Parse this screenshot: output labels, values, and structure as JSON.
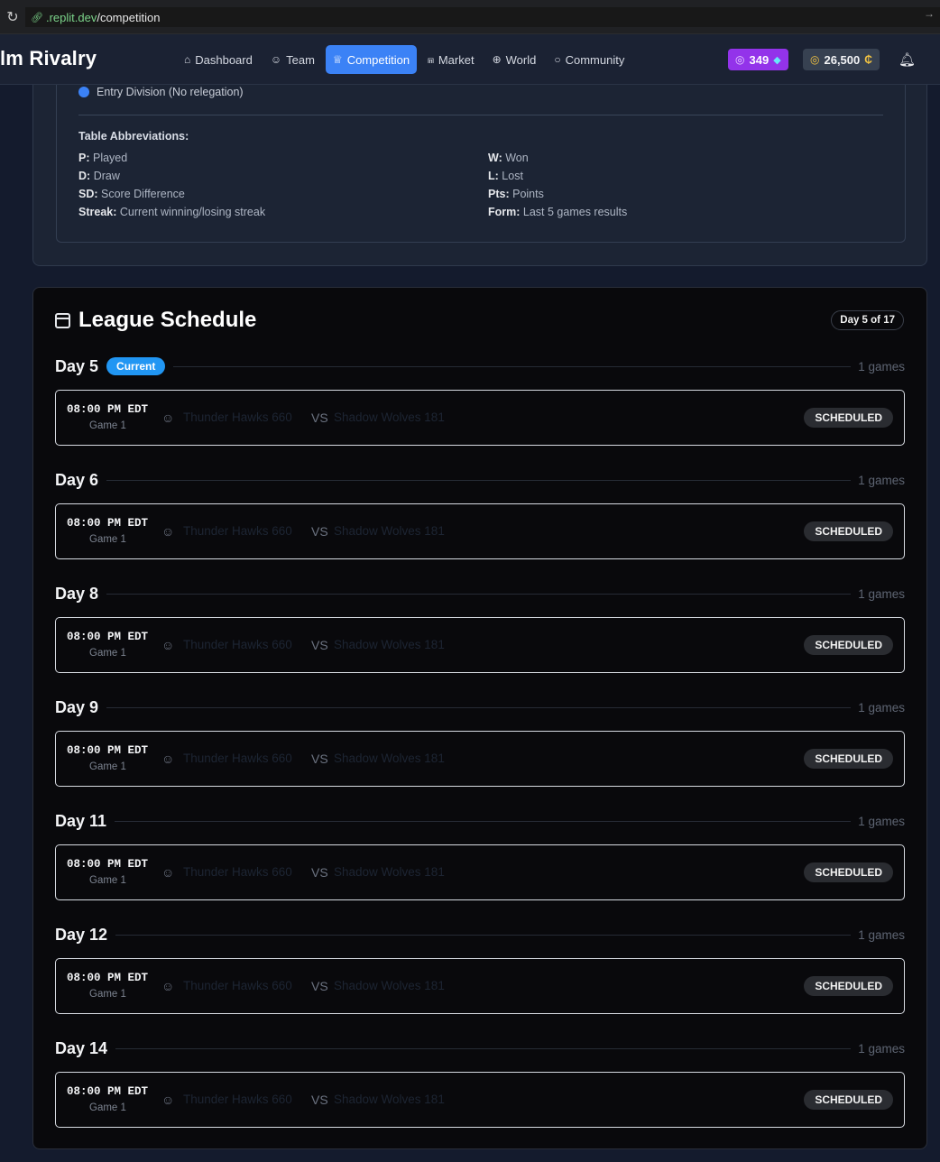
{
  "browser": {
    "url_domain": ".replit.dev",
    "url_path": "/competition"
  },
  "app": {
    "brand": "lm Rivalry",
    "nav": [
      {
        "label": "Dashboard",
        "icon": "home-icon"
      },
      {
        "label": "Team",
        "icon": "users-icon"
      },
      {
        "label": "Competition",
        "icon": "trophy-icon"
      },
      {
        "label": "Market",
        "icon": "cart-icon"
      },
      {
        "label": "World",
        "icon": "globe-icon"
      },
      {
        "label": "Community",
        "icon": "chat-icon"
      }
    ],
    "active_nav": "Competition",
    "gems": "349",
    "coins": "26,500",
    "coin_symbol": "₵"
  },
  "legend": {
    "entry_division": "Entry Division (No relegation)",
    "abbr_title": "Table Abbreviations:",
    "abbreviations": [
      {
        "key": "P:",
        "desc": "Played"
      },
      {
        "key": "W:",
        "desc": "Won"
      },
      {
        "key": "D:",
        "desc": "Draw"
      },
      {
        "key": "L:",
        "desc": "Lost"
      },
      {
        "key": "SD:",
        "desc": "Score Difference"
      },
      {
        "key": "Pts:",
        "desc": "Points"
      },
      {
        "key": "Streak:",
        "desc": "Current winning/losing streak"
      },
      {
        "key": "Form:",
        "desc": "Last 5 games results"
      }
    ]
  },
  "schedule": {
    "title": "League Schedule",
    "day_badge": "Day 5 of 17",
    "current_label": "Current",
    "days": [
      {
        "label": "Day 5",
        "current": true,
        "count": "1 games",
        "game": {
          "time": "08:00 PM EDT",
          "sub": "Game 1",
          "home": "Thunder Hawks 660",
          "vs": "VS",
          "away": "Shadow Wolves 181",
          "status": "SCHEDULED"
        }
      },
      {
        "label": "Day 6",
        "current": false,
        "count": "1 games",
        "game": {
          "time": "08:00 PM EDT",
          "sub": "Game 1",
          "home": "Thunder Hawks 660",
          "vs": "VS",
          "away": "Shadow Wolves 181",
          "status": "SCHEDULED"
        }
      },
      {
        "label": "Day 8",
        "current": false,
        "count": "1 games",
        "game": {
          "time": "08:00 PM EDT",
          "sub": "Game 1",
          "home": "Thunder Hawks 660",
          "vs": "VS",
          "away": "Shadow Wolves 181",
          "status": "SCHEDULED"
        }
      },
      {
        "label": "Day 9",
        "current": false,
        "count": "1 games",
        "game": {
          "time": "08:00 PM EDT",
          "sub": "Game 1",
          "home": "Thunder Hawks 660",
          "vs": "VS",
          "away": "Shadow Wolves 181",
          "status": "SCHEDULED"
        }
      },
      {
        "label": "Day 11",
        "current": false,
        "count": "1 games",
        "game": {
          "time": "08:00 PM EDT",
          "sub": "Game 1",
          "home": "Thunder Hawks 660",
          "vs": "VS",
          "away": "Shadow Wolves 181",
          "status": "SCHEDULED"
        }
      },
      {
        "label": "Day 12",
        "current": false,
        "count": "1 games",
        "game": {
          "time": "08:00 PM EDT",
          "sub": "Game 1",
          "home": "Thunder Hawks 660",
          "vs": "VS",
          "away": "Shadow Wolves 181",
          "status": "SCHEDULED"
        }
      },
      {
        "label": "Day 14",
        "current": false,
        "count": "1 games",
        "game": {
          "time": "08:00 PM EDT",
          "sub": "Game 1",
          "home": "Thunder Hawks 660",
          "vs": "VS",
          "away": "Shadow Wolves 181",
          "status": "SCHEDULED"
        }
      }
    ]
  }
}
